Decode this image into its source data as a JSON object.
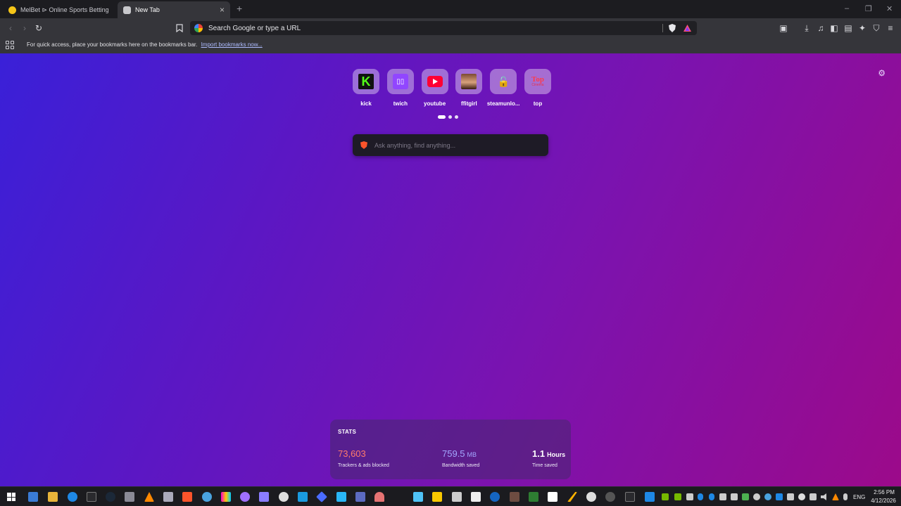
{
  "tabs": [
    {
      "title": "MelBet ⊳ Online Sports Betting ⊳ Me",
      "favicon_color": "#f5c518",
      "active": false
    },
    {
      "title": "New Tab",
      "favicon_color": "#c8c8cc",
      "active": true
    }
  ],
  "tab_close_glyph": "×",
  "new_tab_glyph": "+",
  "window_controls": {
    "minimize": "–",
    "restore": "❐",
    "close": "✕"
  },
  "omnibox": {
    "placeholder": "Search Google or type a URL"
  },
  "bookmarks_bar": {
    "message": "For quick access, place your bookmarks here on the bookmarks bar.",
    "import_link": "Import bookmarks now..."
  },
  "top_sites": [
    {
      "name": "kick",
      "icon": "kick-icon"
    },
    {
      "name": "twich",
      "icon": "twitch-icon"
    },
    {
      "name": "youtube",
      "icon": "youtube-icon"
    },
    {
      "name": "ffitgirl",
      "icon": "site-thumbnail-icon"
    },
    {
      "name": "steamunlo...",
      "icon": "lock-icon"
    },
    {
      "name": "top",
      "icon": "top-cinema-icon",
      "logo_line1": "Top",
      "logo_line2": "Cinema"
    }
  ],
  "pagination": {
    "pages": 3,
    "active": 1
  },
  "ask_box": {
    "placeholder": "Ask anything, find anything..."
  },
  "stats": {
    "header": "STATS",
    "trackers": {
      "value": "73,603",
      "unit": "",
      "label": "Trackers & ads blocked",
      "color": "#ff7b6b"
    },
    "bandwidth": {
      "value": "759.5",
      "unit": "MB",
      "label": "Bandwidth saved",
      "color": "#a3a7ff"
    },
    "time": {
      "value": "1.1",
      "unit": "Hours",
      "label": "Time saved",
      "color": "#ffffff"
    }
  },
  "taskbar": {
    "language": "ENG",
    "time": "2:56 PM",
    "date": "4/12/2026"
  },
  "colors": {
    "ntp_gradient_start": "#3a20d8",
    "ntp_gradient_end": "#9c0a8a",
    "accent_brave": "#fb542b"
  }
}
